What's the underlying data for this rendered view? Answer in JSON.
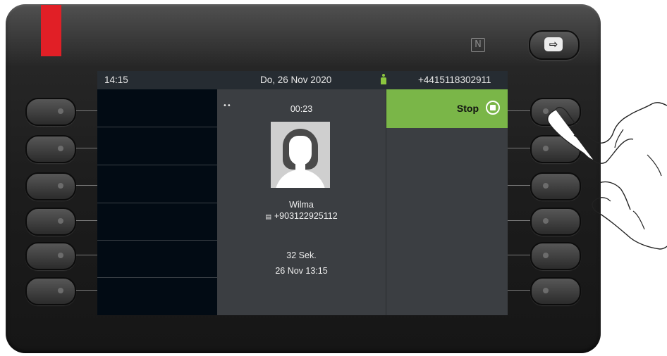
{
  "status_bar": {
    "time": "14:15",
    "date": "Do, 26 Nov 2020",
    "own_number": "+4415118302911",
    "presence_color": "#8cc63f"
  },
  "call": {
    "voicemail_icon": "voicemail-icon",
    "elapsed": "00:23",
    "contact_name": "Wilma",
    "contact_number": "+903122925112",
    "number_type_icon": "business-phone-icon",
    "duration": "32 Sek.",
    "timestamp": "26 Nov 13:15"
  },
  "softkey": {
    "stop_label": "Stop",
    "stop_icon": "stop-icon",
    "accent_color": "#7ab648"
  },
  "device": {
    "nfc_icon": "nfc-icon",
    "logout_icon": "logout-icon",
    "brand_color": "#e11f26"
  }
}
